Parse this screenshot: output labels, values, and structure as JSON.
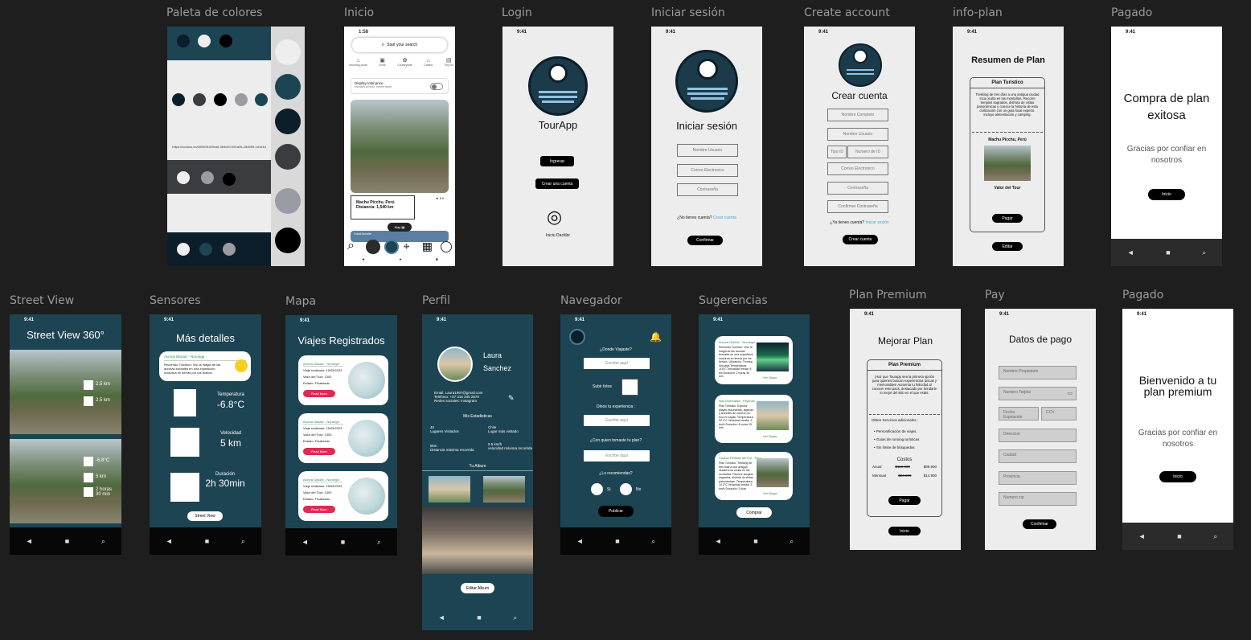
{
  "labels": {
    "paleta": "Paleta de colores",
    "inicio": "Inicio",
    "login": "Login",
    "iniciar": "Iniciar sesión",
    "create": "Create account",
    "info": "info-plan",
    "pagado1": "Pagado",
    "street": "Street View",
    "sensores": "Sensores",
    "mapa": "Mapa",
    "perfil": "Perfil",
    "navegador": "Navegador",
    "sugerencias": "Sugerencias",
    "premium": "Plan Premium",
    "pay": "Pay",
    "pagado2": "Pagado"
  },
  "time": "9:41",
  "palette": {
    "url": "https://coolors.co/000505-60fca0-3b3c40-051a26-284559-1d1d1d",
    "colors": [
      "#1c4452",
      "#0c1e2a",
      "#3b3c40",
      "#9a9ca4",
      "#000000",
      "#eeeeee"
    ]
  },
  "inicio": {
    "time": "1:58",
    "search": "Start your search",
    "cats": [
      "Amazing pools",
      "Icons",
      "Countryside",
      "Cabins",
      "Tiny ho"
    ],
    "toggle_title": "Display total price",
    "toggle_sub": "Includes all fees, before taxes",
    "place": "Machu Picchu, Perú",
    "distance": "Distancia: 1,540 km",
    "rating": "★ 5.0",
    "map_btn": "Map",
    "guest": "Guest favorite"
  },
  "login": {
    "brand": "TourApp",
    "ingresar": "Ingresar",
    "crear": "Crear una cuenta",
    "finger": "Inicio Dactilar"
  },
  "signin": {
    "title": "Iniciar sesión",
    "user": "Nombre Usuario",
    "email": "Correo Electronico",
    "pass": "Contraseña",
    "noacc": "¿No tienes cuenta?",
    "create_link": "Crear cuenta",
    "confirm": "Confirmar"
  },
  "create": {
    "title": "Crear cuenta",
    "full": "Nombre Completo",
    "user": "Nombre Usuario",
    "idtype": "Tipo ID",
    "idnum": "Numero de ID",
    "email": "Correo Electronico",
    "pass": "Contraseña",
    "confirm_pass": "Confirmar Contraseña",
    "have": "¿Ya tienes cuenta?",
    "login_link": "Iniciar sesión",
    "btn": "Crear cuenta"
  },
  "infoplan": {
    "title": "Resumen de Plan",
    "card_title": "Plan Turistico",
    "desc": "Trekking de tres días a una antigua ciudad Inca oculta en las montañas. Recorre templos sagrados, disfruta de vistas panorámicas y conoce la historia de esta civilización con un guía local experto. Incluye alimentación y camping.",
    "place": "Machu Picchu, Perú",
    "value": "Valor del Tour",
    "pay": "Pagar",
    "edit": "Editar"
  },
  "paid1": {
    "title": "Compra de plan exitosa",
    "thanks": "Gracias por confiar en nosotros",
    "btn": "Inicio"
  },
  "street": {
    "title": "Street View 360°",
    "b1": [
      "2.5 km",
      "2.5 km"
    ],
    "b2": [
      "-6.8°C",
      "5 km",
      "2 horas 30 min"
    ]
  },
  "sensores": {
    "title": "Más detalles",
    "card_title": "Aurora Glaciar - Noruega",
    "card_desc": "Recorrido Turístico: Viví la magia de las auroras boreales en una expedición nocturna en tierras por los fiordos.",
    "temp_label": "Temperatura",
    "temp_val": "-6.8°C",
    "vel_label": "Velocidad",
    "vel_val": "5 km",
    "dur_label": "Duración",
    "dur_val": "2h 30min",
    "btn": "Street View"
  },
  "mapa": {
    "title": "Viajes Registrados",
    "trips": [
      {
        "name": "Aurora Glaciar - Noruega",
        "l1": "Viaje realizado: 15/03/2023",
        "l2": "Valor del Tour: 1300",
        "l3": "Estado: Finalizado",
        "btn": "Read More"
      },
      {
        "name": "Aurora Glaciar - Noruega",
        "l1": "Viaje realizado: 15/03/2023",
        "l2": "Valor del Tour: 1300",
        "l3": "Estado: Finalizado",
        "btn": "Read More"
      },
      {
        "name": "Aurora Glaciar - Noruega",
        "l1": "Viaje realizado: 15/03/2023",
        "l2": "Valor del Tour: 1300",
        "l3": "Estado: Finalizado",
        "btn": "Read More"
      }
    ]
  },
  "perfil": {
    "name1": "Laura",
    "name2": "Sanchez",
    "email": "Email: Laura1997@gmail.com",
    "phone": "Telefono: +57 315 345 2879",
    "social": "Redes sociales: Instagram",
    "stats_title": "Mis Estadisticas",
    "s1v": "40",
    "s1l": "Lugares Visitados",
    "s2v": "Chile",
    "s2l": "Lugar más visitado",
    "s3v": "6km",
    "s3l": "Distancia máxima recorrida",
    "s4v": "0.5 km/h",
    "s4l": "velocidad máxima recorrida",
    "album": "Tu Album",
    "btn": "Editar Album"
  },
  "navegador": {
    "q1": "¿Donde Viajaste?",
    "p1": "Escribe aquí",
    "upload": "Subir fotos",
    "q2": "Dinos tu experiencia :",
    "p2": "Escribe aquí",
    "q3": "¿Con quien tomaste tu plan?",
    "p3": "Escribe aquí",
    "q4": "¿Lo recomiendas?",
    "yes": "Si",
    "no": "No",
    "btn": "Publicar"
  },
  "sugerencias": {
    "items": [
      {
        "name": "Aurora Glaciar - Noruega",
        "desc": "Recorrido Turístico: Vive la magia de las auroras boreales en una expedición nocturna en tierras por los fiordos. Ubicación: Tromsø, Noruega Temperatura: -6.8°C Velocidad media: 5 km Duración: 2 horas 30 min",
        "cta": "Ver Mapa"
      },
      {
        "name": "Isla Esmeralda - Filipinas",
        "desc": "Plan Turístico: Explora playas escondidas, lagunas y arrecifes de coral en un tour en kayak. Temperatura: 32.4°C Velocidad media: 3 km/h Duración: 4 horas 15 min",
        "cta": "Ver Mapa"
      },
      {
        "name": "Ciudad Perdida del Sol - Perú",
        "desc": "Plan Turístico: Trekking de tres días a una antigua ciudad Inca oculta en las montañas. Recorre templos sagrados, disfruta de vistas panorámicas. Temperatura: 14.2°C Velocidad media: 2 km/h Duración: 3 días",
        "cta": "Ver Mapa"
      }
    ],
    "btn": "Comprar"
  },
  "premium": {
    "title": "Mejorar Plan",
    "card_title": "Plan Premium",
    "desc": "¡Haz que Tourapp sea la primera opción para quienes buscan experiencias únicas y memorables! Aumenta tu felicidad al conocer este pack, destacado por brindarte lo mejor del sitio en el que estás.",
    "services_title": "Obten Servicios adicionales :",
    "services": [
      "Personificación de viajes.",
      "Guias de running turísticas",
      "Sin limite de búsquedas"
    ],
    "costs": "Costos",
    "anual": "Anual",
    "anual_old": "$119.900",
    "anual_new": "$99.900",
    "mensual": "Mensual",
    "mensual_old": "$24.900",
    "mensual_new": "$14.900",
    "pay": "Pagar",
    "home": "Inicio"
  },
  "pay": {
    "title": "Datos de pago",
    "owner": "Nombre Propietario",
    "card": "Numero Tarjeta",
    "exp": "Fecha Expiración",
    "cvv": "CCV",
    "addr": "Direccion",
    "city": "Ciudad",
    "prov": "Provincia",
    "zip": "Numero zip",
    "btn": "Confirmar"
  },
  "paid2": {
    "title": "Bienvenido a tu plan premium",
    "thanks": "Gracias por confiar en nosotros",
    "btn": "Inicio"
  }
}
